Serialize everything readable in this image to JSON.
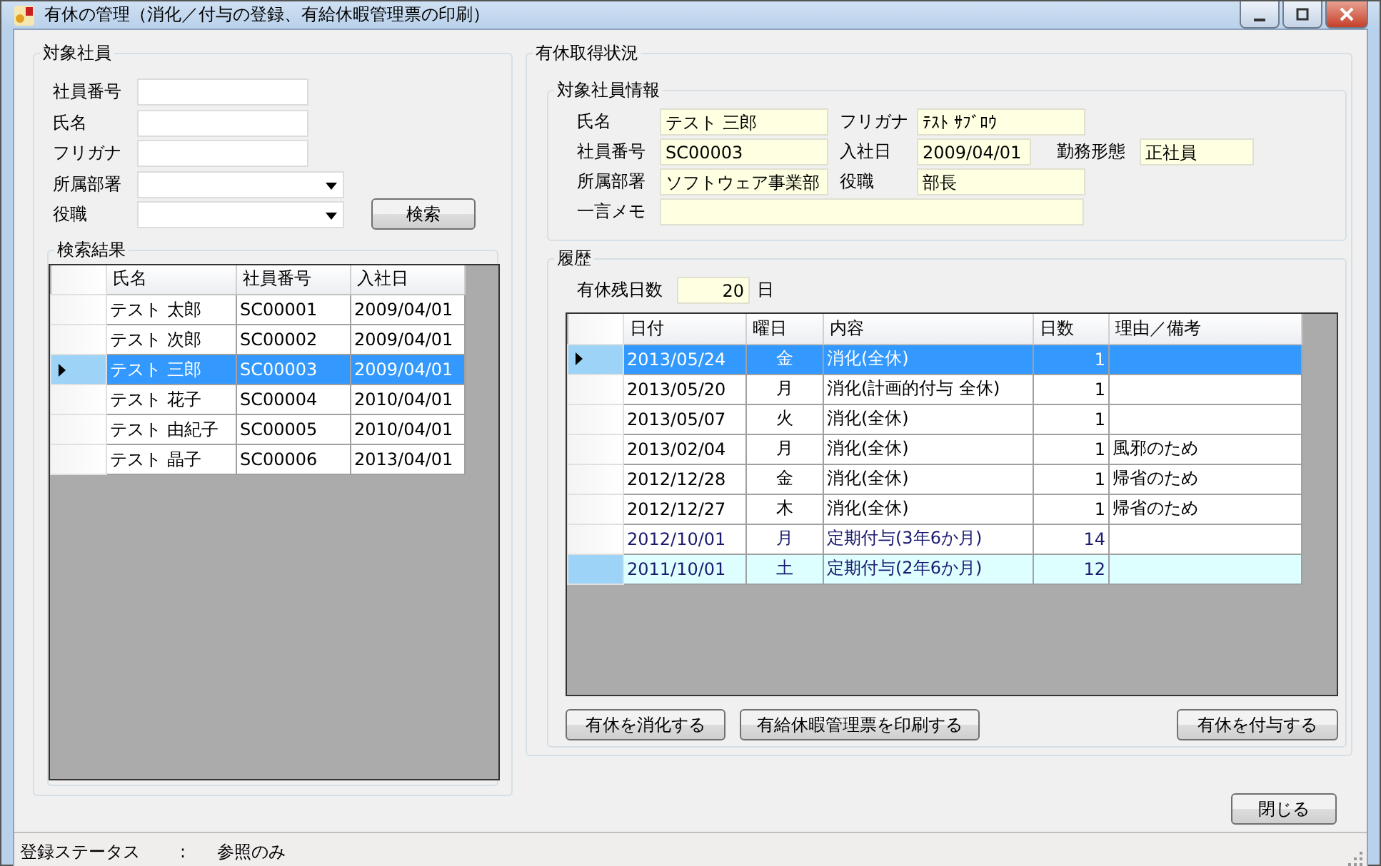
{
  "window": {
    "title": "有休の管理（消化／付与の登録、有給休暇管理票の印刷）"
  },
  "search_panel": {
    "title": "対象社員",
    "fields": [
      {
        "kind": "text",
        "label": "社員番号"
      },
      {
        "kind": "text",
        "label": "氏名"
      },
      {
        "kind": "text",
        "label": "フリガナ"
      },
      {
        "kind": "combo",
        "label": "所属部署"
      },
      {
        "kind": "combo",
        "label": "役職"
      }
    ],
    "search_button": "検索",
    "results": {
      "title": "検索結果",
      "columns": [
        "氏名",
        "社員番号",
        "入社日"
      ],
      "rows": [
        {
          "cells": [
            "テスト 太郎",
            "SC00001",
            "2009/04/01"
          ],
          "selected": false
        },
        {
          "cells": [
            "テスト 次郎",
            "SC00002",
            "2009/04/01"
          ],
          "selected": false
        },
        {
          "cells": [
            "テスト 三郎",
            "SC00003",
            "2009/04/01"
          ],
          "selected": true
        },
        {
          "cells": [
            "テスト 花子",
            "SC00004",
            "2010/04/01"
          ],
          "selected": false
        },
        {
          "cells": [
            "テスト 由紀子",
            "SC00005",
            "2010/04/01"
          ],
          "selected": false
        },
        {
          "cells": [
            "テスト 晶子",
            "SC00006",
            "2013/04/01"
          ],
          "selected": false
        }
      ]
    }
  },
  "status_panel": {
    "title": "有休取得状況",
    "employee_info": {
      "title": "対象社員情報",
      "rows": [
        [
          {
            "label": "氏名",
            "value": "テスト 三郎"
          },
          {
            "label": "フリガナ",
            "value": "ﾃｽﾄ ｻﾌﾞﾛｳ"
          }
        ],
        [
          {
            "label": "社員番号",
            "value": "SC00003"
          },
          {
            "label": "入社日",
            "value": "2009/04/01"
          },
          {
            "label": "勤務形態",
            "value": "正社員"
          }
        ],
        [
          {
            "label": "所属部署",
            "value": "ソフトウェア事業部"
          },
          {
            "label": "役職",
            "value": "部長"
          }
        ],
        [
          {
            "label": "一言メモ"
          }
        ]
      ]
    },
    "history": {
      "title": "履歴",
      "remaining_label": "有休残日数",
      "remaining_value": "20",
      "remaining_unit": "日",
      "columns": [
        "日付",
        "曜日",
        "内容",
        "日数",
        "理由／備考"
      ],
      "rows": [
        {
          "kind": "consume",
          "selected": true,
          "highlighted": false,
          "cells": [
            "2013/05/24",
            "金",
            "消化(全休)",
            "1",
            ""
          ]
        },
        {
          "kind": "consume",
          "selected": false,
          "highlighted": false,
          "cells": [
            "2013/05/20",
            "月",
            "消化(計画的付与 全休)",
            "1",
            ""
          ]
        },
        {
          "kind": "consume",
          "selected": false,
          "highlighted": false,
          "cells": [
            "2013/05/07",
            "火",
            "消化(全休)",
            "1",
            ""
          ]
        },
        {
          "kind": "consume",
          "selected": false,
          "highlighted": false,
          "cells": [
            "2013/02/04",
            "月",
            "消化(全休)",
            "1",
            "風邪のため"
          ]
        },
        {
          "kind": "consume",
          "selected": false,
          "highlighted": false,
          "cells": [
            "2012/12/28",
            "金",
            "消化(全休)",
            "1",
            "帰省のため"
          ]
        },
        {
          "kind": "consume",
          "selected": false,
          "highlighted": false,
          "cells": [
            "2012/12/27",
            "木",
            "消化(全休)",
            "1",
            "帰省のため"
          ]
        },
        {
          "kind": "grant",
          "selected": false,
          "highlighted": false,
          "cells": [
            "2012/10/01",
            "月",
            "定期付与(3年6か月)",
            "14",
            ""
          ]
        },
        {
          "kind": "grant",
          "selected": false,
          "highlighted": true,
          "cells": [
            "2011/10/01",
            "土",
            "定期付与(2年6か月)",
            "12",
            ""
          ]
        }
      ]
    },
    "buttons": [
      "有休を消化する",
      "有給休暇管理票を印刷する",
      "有休を付与する"
    ]
  },
  "close_button": "閉じる",
  "status_bar": {
    "label": "登録ステータス",
    "separator": ":",
    "value": "参照のみ"
  }
}
